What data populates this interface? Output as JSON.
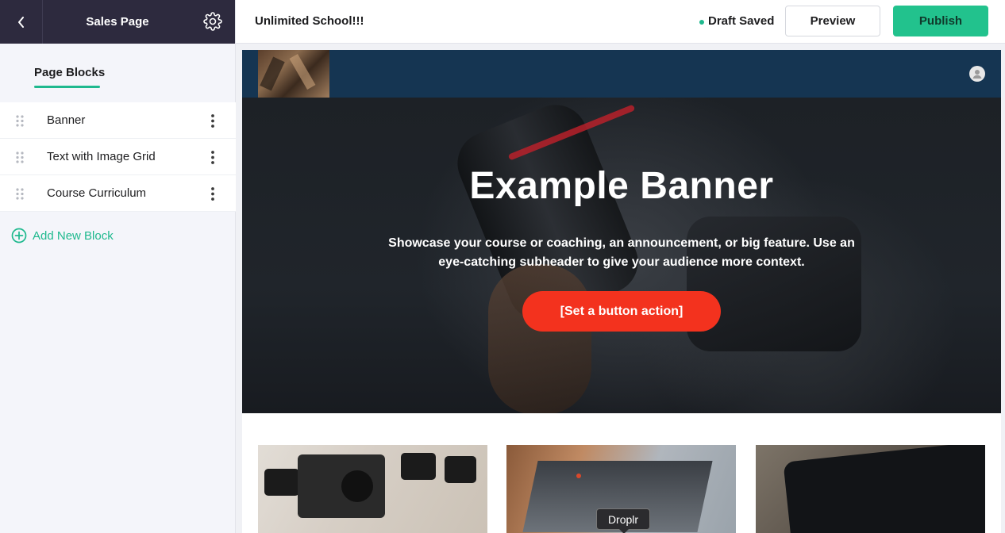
{
  "sidebar": {
    "title": "Sales Page",
    "tab": "Page Blocks",
    "blocks": [
      {
        "label": "Banner"
      },
      {
        "label": "Text with Image Grid"
      },
      {
        "label": "Course Curriculum"
      }
    ],
    "add_block_label": "Add New Block"
  },
  "topbar": {
    "school_name": "Unlimited School!!!",
    "status": "Draft Saved",
    "preview_label": "Preview",
    "publish_label": "Publish"
  },
  "banner": {
    "title": "Example Banner",
    "subtitle": "Showcase your course or coaching, an announcement, or big feature. Use an eye-catching subheader to give your audience more context.",
    "button_label": "[Set a button action]"
  },
  "tooltip": "Droplr",
  "colors": {
    "sidebar_header": "#2d2a3e",
    "accent": "#1fb98e",
    "publish": "#22c28d",
    "site_nav": "#153552",
    "banner_button": "#f3321e"
  }
}
